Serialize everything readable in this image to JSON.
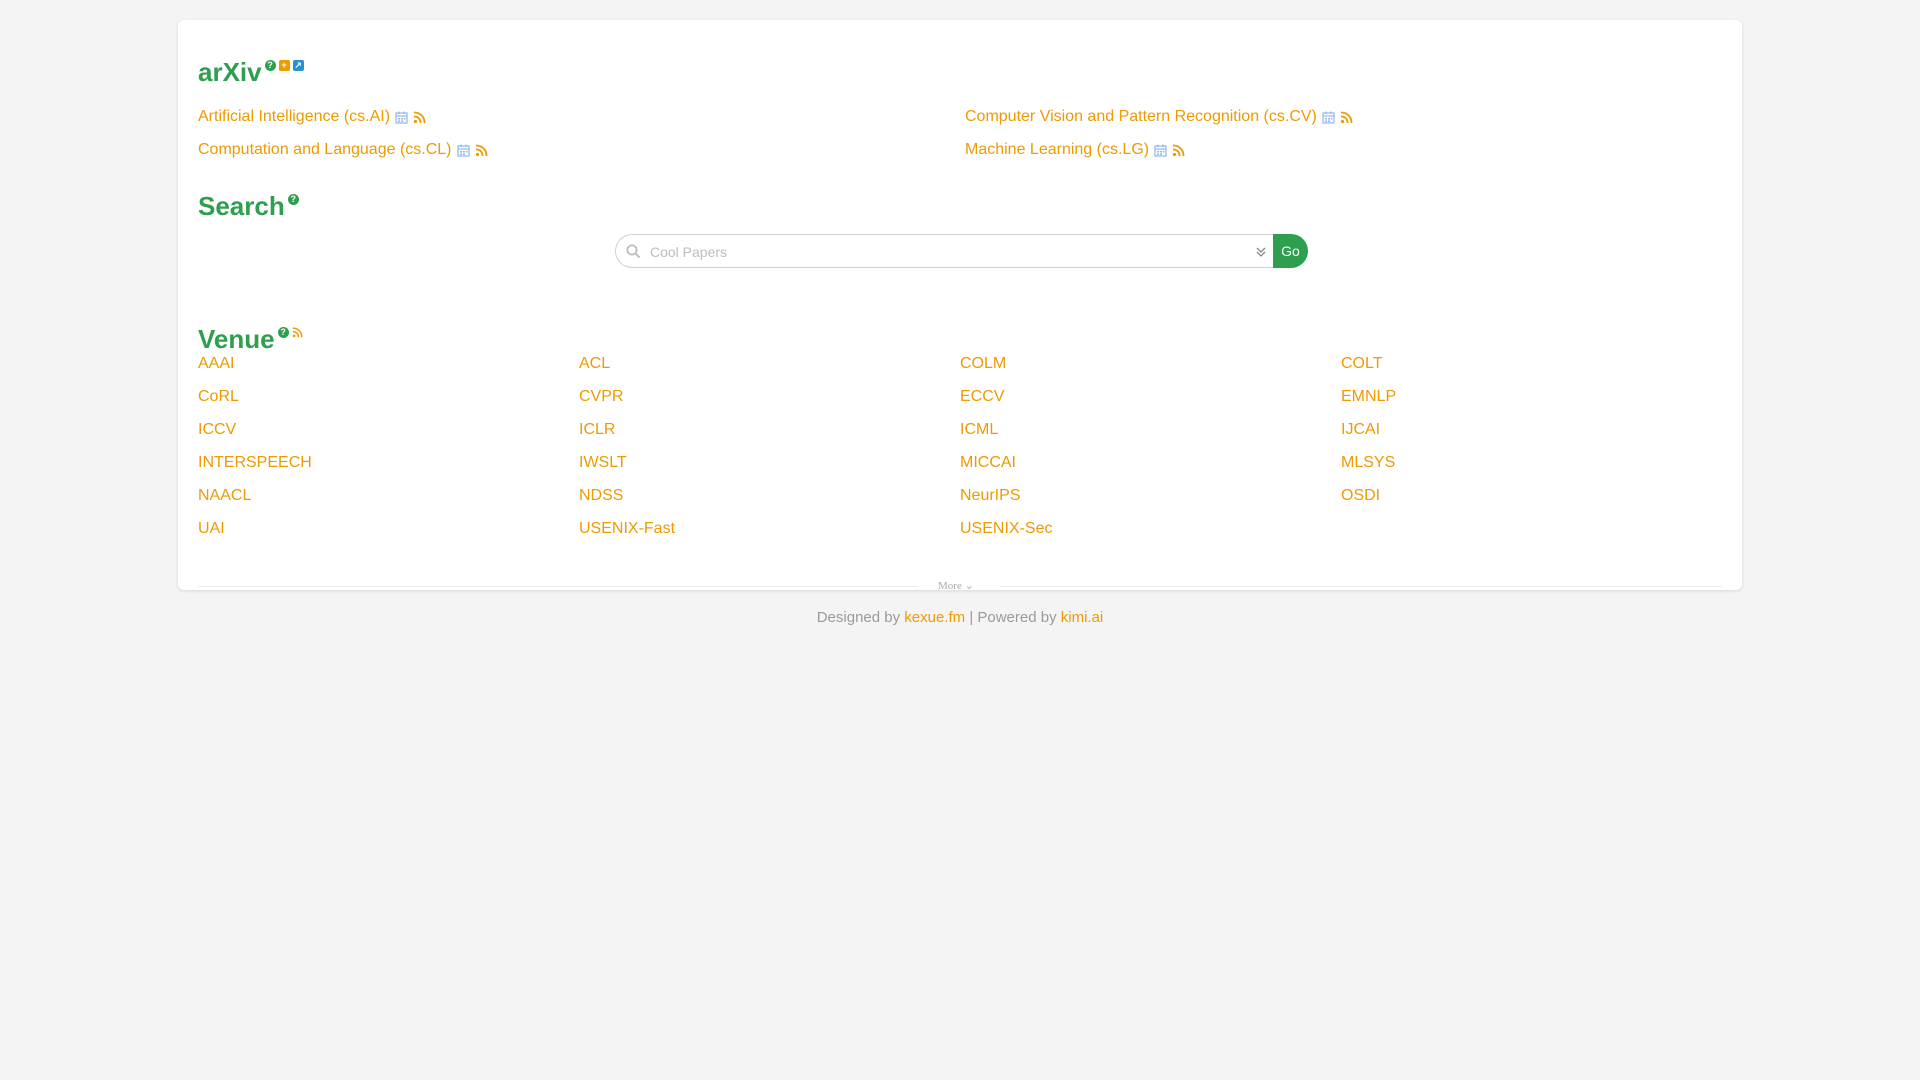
{
  "arxiv": {
    "title": "arXiv",
    "help_glyph": "?",
    "plus_glyph": "+",
    "link_glyph": "↗",
    "categories": [
      {
        "label": "Artificial Intelligence (cs.AI)"
      },
      {
        "label": "Computer Vision and Pattern Recognition (cs.CV)"
      },
      {
        "label": "Computation and Language (cs.CL)"
      },
      {
        "label": "Machine Learning (cs.LG)"
      }
    ]
  },
  "search": {
    "title": "Search",
    "help_glyph": "?",
    "placeholder": "Cool Papers",
    "go_label": "Go"
  },
  "venue": {
    "title": "Venue",
    "help_glyph": "?",
    "items": [
      "AAAI",
      "ACL",
      "COLM",
      "COLT",
      "CoRL",
      "CVPR",
      "ECCV",
      "EMNLP",
      "ICCV",
      "ICLR",
      "ICML",
      "IJCAI",
      "INTERSPEECH",
      "IWSLT",
      "MICCAI",
      "MLSYS",
      "NAACL",
      "NDSS",
      "NeurIPS",
      "OSDI",
      "UAI",
      "USENIX-Fast",
      "USENIX-Sec"
    ],
    "more_label": "More",
    "more_chevron": "⌄"
  },
  "footer": {
    "designed_by": "Designed by",
    "designer_link": "kexue.fm",
    "separator": "| Powered by",
    "power_link": "kimi.ai"
  },
  "colors": {
    "accent_green": "#2e9e4f",
    "link_orange": "#ee9a00",
    "calendar_blue": "#8fb8e6"
  }
}
